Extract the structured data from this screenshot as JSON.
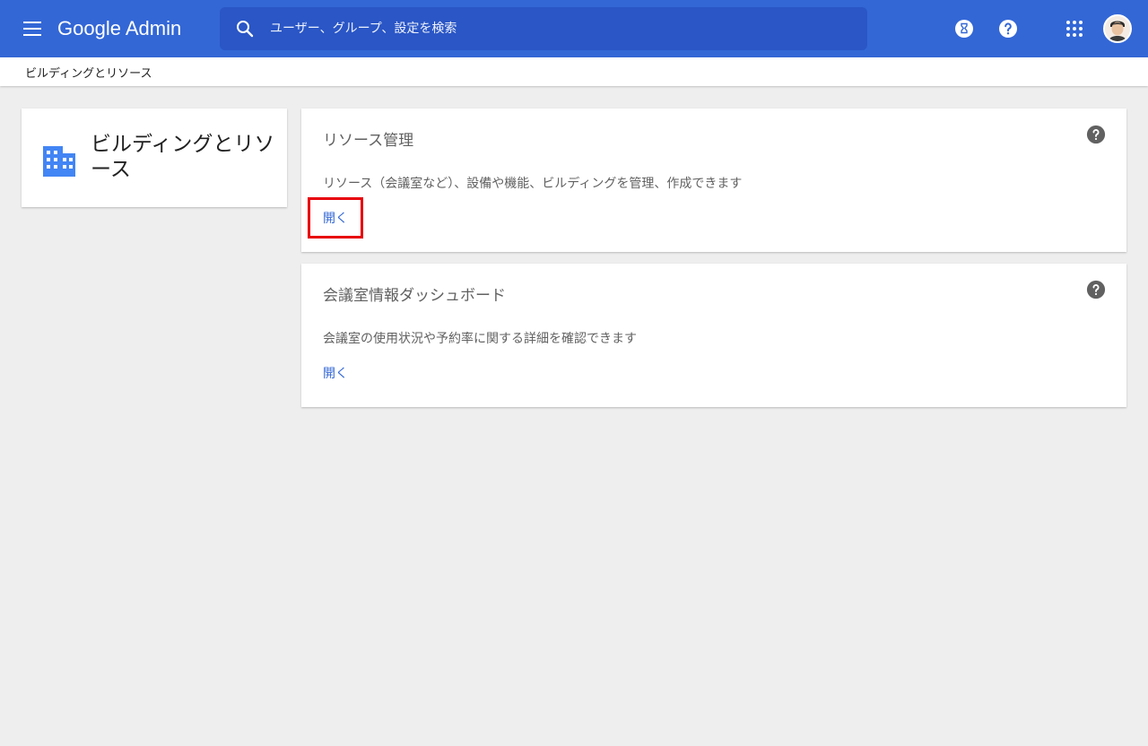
{
  "app": {
    "logo_text": "Google Admin"
  },
  "search": {
    "placeholder": "ユーザー、グループ、設定を検索"
  },
  "breadcrumb": "ビルディングとリソース",
  "sidebar_card": {
    "title": "ビルディングとリソース",
    "icon": "building-icon"
  },
  "cards": [
    {
      "title": "リソース管理",
      "description": "リソース（会議室など）、設備や機能、ビルディングを管理、作成できます",
      "link_label": "開く"
    },
    {
      "title": "会議室情報ダッシュボード",
      "description": "会議室の使用状況や予約率に関する詳細を確認できます",
      "link_label": "開く"
    }
  ],
  "colors": {
    "header": "#3367d6",
    "search_bg": "#2a56c6",
    "link": "#3367d6",
    "highlight": "#e8000b",
    "background": "#eeeeee"
  },
  "icons": {
    "menu": "menu-icon",
    "search": "search-icon",
    "hourglass": "hourglass-icon",
    "help": "help-icon",
    "apps": "apps-grid-icon",
    "avatar": "avatar"
  }
}
